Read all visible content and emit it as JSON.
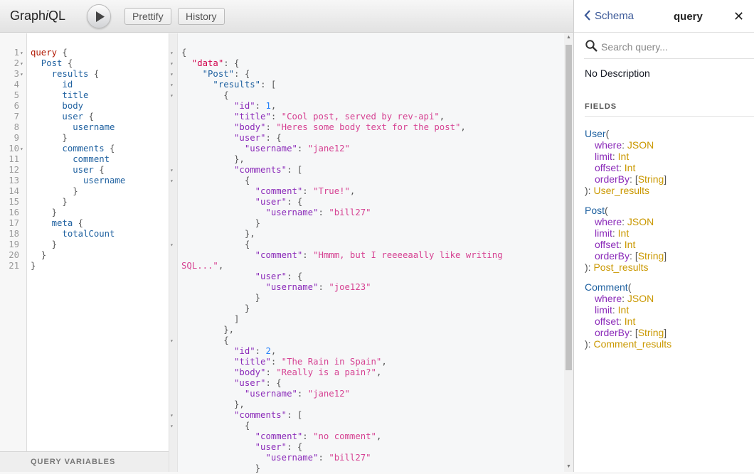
{
  "app": {
    "logo_prefix": "Graph",
    "logo_i": "i",
    "logo_suffix": "QL"
  },
  "toolbar": {
    "prettify_label": "Prettify",
    "history_label": "History"
  },
  "query_editor": {
    "lines": [
      {
        "n": "1",
        "fold": "▾",
        "tokens": [
          {
            "c": "kw",
            "t": "query"
          },
          {
            "c": "punc",
            "t": " {"
          }
        ]
      },
      {
        "n": "2",
        "fold": "▾",
        "tokens": [
          {
            "c": "prop",
            "t": "  Post"
          },
          {
            "c": "punc",
            "t": " {"
          }
        ]
      },
      {
        "n": "3",
        "fold": "▾",
        "tokens": [
          {
            "c": "prop",
            "t": "    results"
          },
          {
            "c": "punc",
            "t": " {"
          }
        ]
      },
      {
        "n": "4",
        "fold": "",
        "tokens": [
          {
            "c": "prop",
            "t": "      id"
          }
        ]
      },
      {
        "n": "5",
        "fold": "",
        "tokens": [
          {
            "c": "prop",
            "t": "      title"
          }
        ]
      },
      {
        "n": "6",
        "fold": "",
        "tokens": [
          {
            "c": "prop",
            "t": "      body"
          }
        ]
      },
      {
        "n": "7",
        "fold": "",
        "tokens": [
          {
            "c": "prop",
            "t": "      user"
          },
          {
            "c": "punc",
            "t": " {"
          }
        ]
      },
      {
        "n": "8",
        "fold": "",
        "tokens": [
          {
            "c": "prop",
            "t": "        username"
          }
        ]
      },
      {
        "n": "9",
        "fold": "",
        "tokens": [
          {
            "c": "punc",
            "t": "      }"
          }
        ]
      },
      {
        "n": "10",
        "fold": "▾",
        "tokens": [
          {
            "c": "prop",
            "t": "      comments"
          },
          {
            "c": "punc",
            "t": " {"
          }
        ]
      },
      {
        "n": "11",
        "fold": "",
        "tokens": [
          {
            "c": "prop",
            "t": "        comment"
          }
        ]
      },
      {
        "n": "12",
        "fold": "",
        "tokens": [
          {
            "c": "prop",
            "t": "        user"
          },
          {
            "c": "punc",
            "t": " {"
          }
        ]
      },
      {
        "n": "13",
        "fold": "",
        "tokens": [
          {
            "c": "prop",
            "t": "          username"
          }
        ]
      },
      {
        "n": "14",
        "fold": "",
        "tokens": [
          {
            "c": "punc",
            "t": "        }"
          }
        ]
      },
      {
        "n": "15",
        "fold": "",
        "tokens": [
          {
            "c": "punc",
            "t": "      }"
          }
        ]
      },
      {
        "n": "16",
        "fold": "",
        "tokens": [
          {
            "c": "punc",
            "t": "    }"
          }
        ]
      },
      {
        "n": "17",
        "fold": "",
        "tokens": [
          {
            "c": "prop",
            "t": "    meta"
          },
          {
            "c": "punc",
            "t": " {"
          }
        ]
      },
      {
        "n": "18",
        "fold": "",
        "tokens": [
          {
            "c": "prop",
            "t": "      totalCount"
          }
        ]
      },
      {
        "n": "19",
        "fold": "",
        "tokens": [
          {
            "c": "punc",
            "t": "    }"
          }
        ]
      },
      {
        "n": "20",
        "fold": "",
        "tokens": [
          {
            "c": "punc",
            "t": "  }"
          }
        ]
      },
      {
        "n": "21",
        "fold": "",
        "tokens": [
          {
            "c": "punc",
            "t": "}"
          }
        ]
      }
    ],
    "variables_label": "QUERY VARIABLES"
  },
  "result": {
    "lines": [
      {
        "fold": "▾",
        "tokens": [
          {
            "c": "punc2",
            "t": "{"
          }
        ]
      },
      {
        "fold": "▾",
        "tokens": [
          {
            "c": "def",
            "t": "  \"data\""
          },
          {
            "c": "punc2",
            "t": ": {"
          }
        ]
      },
      {
        "fold": "▾",
        "tokens": [
          {
            "c": "prop",
            "t": "    \"Post\""
          },
          {
            "c": "punc2",
            "t": ": {"
          }
        ]
      },
      {
        "fold": "▾",
        "tokens": [
          {
            "c": "prop",
            "t": "      \"results\""
          },
          {
            "c": "punc2",
            "t": ": ["
          }
        ]
      },
      {
        "fold": "▾",
        "tokens": [
          {
            "c": "punc2",
            "t": "        {"
          }
        ]
      },
      {
        "fold": "",
        "tokens": [
          {
            "c": "attr",
            "t": "          \"id\""
          },
          {
            "c": "punc2",
            "t": ": "
          },
          {
            "c": "num",
            "t": "1"
          },
          {
            "c": "punc2",
            "t": ","
          }
        ]
      },
      {
        "fold": "",
        "tokens": [
          {
            "c": "attr",
            "t": "          \"title\""
          },
          {
            "c": "punc2",
            "t": ": "
          },
          {
            "c": "str",
            "t": "\"Cool post, served by rev-api\""
          },
          {
            "c": "punc2",
            "t": ","
          }
        ]
      },
      {
        "fold": "",
        "tokens": [
          {
            "c": "attr",
            "t": "          \"body\""
          },
          {
            "c": "punc2",
            "t": ": "
          },
          {
            "c": "str",
            "t": "\"Heres some body text for the post\""
          },
          {
            "c": "punc2",
            "t": ","
          }
        ]
      },
      {
        "fold": "",
        "tokens": [
          {
            "c": "attr",
            "t": "          \"user\""
          },
          {
            "c": "punc2",
            "t": ": {"
          }
        ]
      },
      {
        "fold": "",
        "tokens": [
          {
            "c": "attr",
            "t": "            \"username\""
          },
          {
            "c": "punc2",
            "t": ": "
          },
          {
            "c": "str",
            "t": "\"jane12\""
          }
        ]
      },
      {
        "fold": "",
        "tokens": [
          {
            "c": "punc2",
            "t": "          },"
          }
        ]
      },
      {
        "fold": "▾",
        "tokens": [
          {
            "c": "attr",
            "t": "          \"comments\""
          },
          {
            "c": "punc2",
            "t": ": ["
          }
        ]
      },
      {
        "fold": "▾",
        "tokens": [
          {
            "c": "punc2",
            "t": "            {"
          }
        ]
      },
      {
        "fold": "",
        "tokens": [
          {
            "c": "attr",
            "t": "              \"comment\""
          },
          {
            "c": "punc2",
            "t": ": "
          },
          {
            "c": "str",
            "t": "\"True!\""
          },
          {
            "c": "punc2",
            "t": ","
          }
        ]
      },
      {
        "fold": "",
        "tokens": [
          {
            "c": "attr",
            "t": "              \"user\""
          },
          {
            "c": "punc2",
            "t": ": {"
          }
        ]
      },
      {
        "fold": "",
        "tokens": [
          {
            "c": "attr",
            "t": "                \"username\""
          },
          {
            "c": "punc2",
            "t": ": "
          },
          {
            "c": "str",
            "t": "\"bill27\""
          }
        ]
      },
      {
        "fold": "",
        "tokens": [
          {
            "c": "punc2",
            "t": "              }"
          }
        ]
      },
      {
        "fold": "",
        "tokens": [
          {
            "c": "punc2",
            "t": "            },"
          }
        ]
      },
      {
        "fold": "▾",
        "tokens": [
          {
            "c": "punc2",
            "t": "            {"
          }
        ]
      },
      {
        "fold": "",
        "tokens": [
          {
            "c": "attr",
            "t": "              \"comment\""
          },
          {
            "c": "punc2",
            "t": ": "
          },
          {
            "c": "str",
            "t": "\"Hmmm, but I reeeeaally like writing"
          }
        ]
      },
      {
        "fold": "",
        "tokens": [
          {
            "c": "str",
            "t": "SQL...\""
          },
          {
            "c": "punc2",
            "t": ","
          }
        ]
      },
      {
        "fold": "",
        "tokens": [
          {
            "c": "attr",
            "t": "              \"user\""
          },
          {
            "c": "punc2",
            "t": ": {"
          }
        ]
      },
      {
        "fold": "",
        "tokens": [
          {
            "c": "attr",
            "t": "                \"username\""
          },
          {
            "c": "punc2",
            "t": ": "
          },
          {
            "c": "str",
            "t": "\"joe123\""
          }
        ]
      },
      {
        "fold": "",
        "tokens": [
          {
            "c": "punc2",
            "t": "              }"
          }
        ]
      },
      {
        "fold": "",
        "tokens": [
          {
            "c": "punc2",
            "t": "            }"
          }
        ]
      },
      {
        "fold": "",
        "tokens": [
          {
            "c": "punc2",
            "t": "          ]"
          }
        ]
      },
      {
        "fold": "",
        "tokens": [
          {
            "c": "punc2",
            "t": "        },"
          }
        ]
      },
      {
        "fold": "▾",
        "tokens": [
          {
            "c": "punc2",
            "t": "        {"
          }
        ]
      },
      {
        "fold": "",
        "tokens": [
          {
            "c": "attr",
            "t": "          \"id\""
          },
          {
            "c": "punc2",
            "t": ": "
          },
          {
            "c": "num",
            "t": "2"
          },
          {
            "c": "punc2",
            "t": ","
          }
        ]
      },
      {
        "fold": "",
        "tokens": [
          {
            "c": "attr",
            "t": "          \"title\""
          },
          {
            "c": "punc2",
            "t": ": "
          },
          {
            "c": "str",
            "t": "\"The Rain in Spain\""
          },
          {
            "c": "punc2",
            "t": ","
          }
        ]
      },
      {
        "fold": "",
        "tokens": [
          {
            "c": "attr",
            "t": "          \"body\""
          },
          {
            "c": "punc2",
            "t": ": "
          },
          {
            "c": "str",
            "t": "\"Really is a pain?\""
          },
          {
            "c": "punc2",
            "t": ","
          }
        ]
      },
      {
        "fold": "",
        "tokens": [
          {
            "c": "attr",
            "t": "          \"user\""
          },
          {
            "c": "punc2",
            "t": ": {"
          }
        ]
      },
      {
        "fold": "",
        "tokens": [
          {
            "c": "attr",
            "t": "            \"username\""
          },
          {
            "c": "punc2",
            "t": ": "
          },
          {
            "c": "str",
            "t": "\"jane12\""
          }
        ]
      },
      {
        "fold": "",
        "tokens": [
          {
            "c": "punc2",
            "t": "          },"
          }
        ]
      },
      {
        "fold": "▾",
        "tokens": [
          {
            "c": "attr",
            "t": "          \"comments\""
          },
          {
            "c": "punc2",
            "t": ": ["
          }
        ]
      },
      {
        "fold": "▾",
        "tokens": [
          {
            "c": "punc2",
            "t": "            {"
          }
        ]
      },
      {
        "fold": "",
        "tokens": [
          {
            "c": "attr",
            "t": "              \"comment\""
          },
          {
            "c": "punc2",
            "t": ": "
          },
          {
            "c": "str",
            "t": "\"no comment\""
          },
          {
            "c": "punc2",
            "t": ","
          }
        ]
      },
      {
        "fold": "",
        "tokens": [
          {
            "c": "attr",
            "t": "              \"user\""
          },
          {
            "c": "punc2",
            "t": ": {"
          }
        ]
      },
      {
        "fold": "",
        "tokens": [
          {
            "c": "attr",
            "t": "                \"username\""
          },
          {
            "c": "punc2",
            "t": ": "
          },
          {
            "c": "str",
            "t": "\"bill27\""
          }
        ]
      },
      {
        "fold": "",
        "tokens": [
          {
            "c": "punc2",
            "t": "              }"
          }
        ]
      }
    ]
  },
  "doc_explorer": {
    "back_label": "Schema",
    "title": "query",
    "close_glyph": "✕",
    "search_placeholder": "Search query...",
    "description": "No Description",
    "fields_title": "FIELDS",
    "fields": [
      {
        "name": "User",
        "args": [
          {
            "n": "where",
            "t": "JSON"
          },
          {
            "n": "limit",
            "t": "Int"
          },
          {
            "n": "offset",
            "t": "Int"
          },
          {
            "n": "orderBy",
            "t": "[String]"
          }
        ],
        "returns": "User_results"
      },
      {
        "name": "Post",
        "args": [
          {
            "n": "where",
            "t": "JSON"
          },
          {
            "n": "limit",
            "t": "Int"
          },
          {
            "n": "offset",
            "t": "Int"
          },
          {
            "n": "orderBy",
            "t": "[String]"
          }
        ],
        "returns": "Post_results"
      },
      {
        "name": "Comment",
        "args": [
          {
            "n": "where",
            "t": "JSON"
          },
          {
            "n": "limit",
            "t": "Int"
          },
          {
            "n": "offset",
            "t": "Int"
          },
          {
            "n": "orderBy",
            "t": "[String]"
          }
        ],
        "returns": "Comment_results"
      }
    ]
  },
  "icons": [
    "play-icon",
    "search-icon",
    "chevron-left-icon",
    "close-icon"
  ]
}
